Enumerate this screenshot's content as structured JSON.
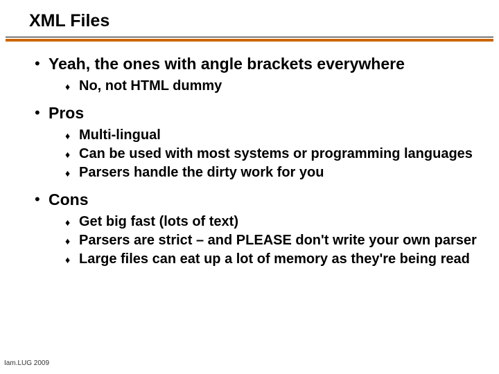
{
  "slide": {
    "title": "XML Files",
    "footer": "Iam.LUG 2009",
    "bullets": [
      {
        "text": "Yeah, the ones with angle brackets everywhere",
        "sub": [
          "No, not HTML dummy"
        ]
      },
      {
        "text": "Pros",
        "sub": [
          "Multi-lingual",
          "Can be used with most systems or programming languages",
          "Parsers handle the dirty work for you"
        ]
      },
      {
        "text": "Cons",
        "sub": [
          "Get big fast (lots of text)",
          "Parsers are strict – and PLEASE don't write your own parser",
          "Large files can eat up a lot of memory as they're being read"
        ]
      }
    ]
  }
}
